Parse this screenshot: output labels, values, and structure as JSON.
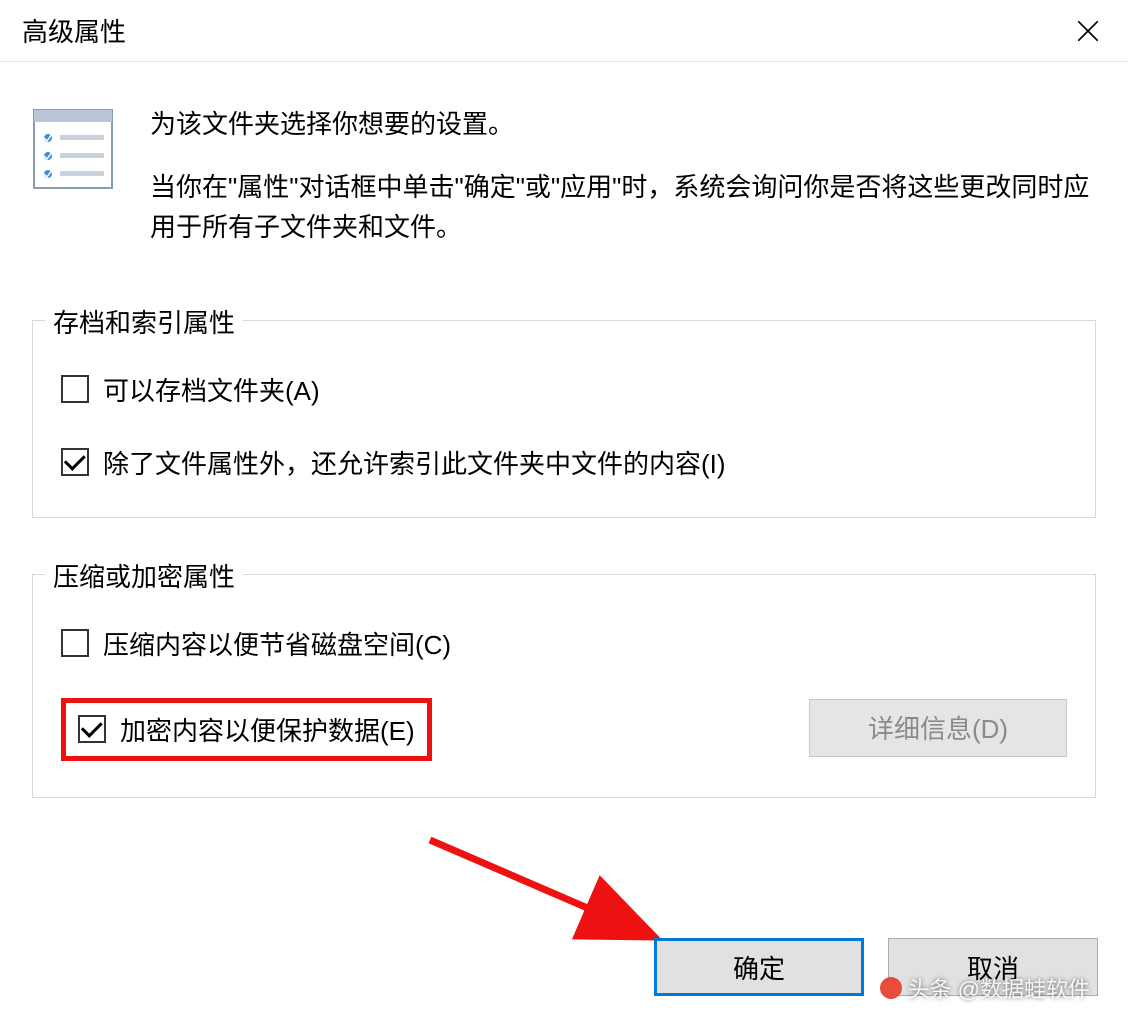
{
  "titlebar": {
    "title": "高级属性"
  },
  "intro": {
    "line1": "为该文件夹选择你想要的设置。",
    "line2": "当你在\"属性\"对话框中单击\"确定\"或\"应用\"时，系统会询问你是否将这些更改同时应用于所有子文件夹和文件。"
  },
  "group1": {
    "title": "存档和索引属性",
    "checkbox1_label": "可以存档文件夹(A)",
    "checkbox2_label": "除了文件属性外，还允许索引此文件夹中文件的内容(I)"
  },
  "group2": {
    "title": "压缩或加密属性",
    "checkbox1_label": "压缩内容以便节省磁盘空间(C)",
    "checkbox2_label": "加密内容以便保护数据(E)",
    "details_label": "详细信息(D)"
  },
  "footer": {
    "ok_label": "确定",
    "cancel_label": "取消"
  },
  "watermark": {
    "text": "头条 @数据蛙软件"
  }
}
